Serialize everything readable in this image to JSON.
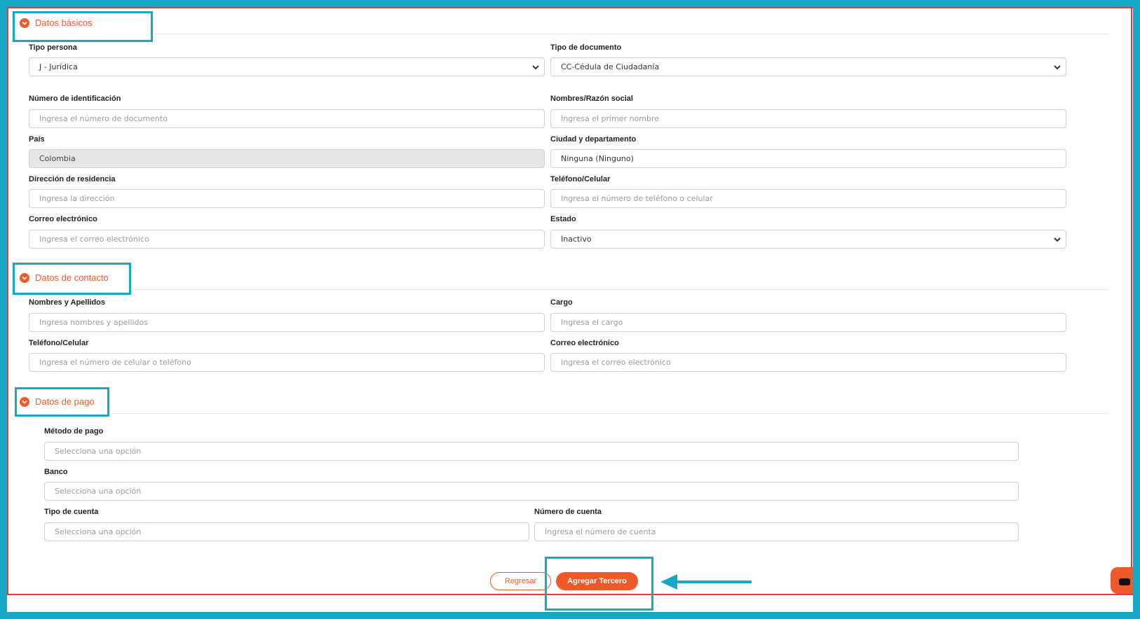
{
  "sections": {
    "basic": "Datos básicos",
    "contact": "Datos de contacto",
    "payment": "Datos de pago"
  },
  "basic": {
    "tipo_persona": {
      "label": "Tipo persona",
      "value": "J - Jurídica"
    },
    "tipo_documento": {
      "label": "Tipo de documento",
      "value": "CC-Cédula de Ciudadanía"
    },
    "numero_id": {
      "label": "Número de identificación",
      "placeholder": "Ingresa el número de documento"
    },
    "nombres": {
      "label": "Nombres/Razón social",
      "placeholder": "Ingresa el primer nombre"
    },
    "pais": {
      "label": "País",
      "value": "Colombia"
    },
    "ciudad": {
      "label": "Ciudad y departamento",
      "value": "Ninguna (Ninguno)"
    },
    "direccion": {
      "label": "Dirección de residencia",
      "placeholder": "Ingresa la dirección"
    },
    "telefono": {
      "label": "Teléfono/Celular",
      "placeholder": "Ingresa el número de teléfono o celular"
    },
    "correo": {
      "label": "Correo electrónico",
      "placeholder": "Ingresa el correo electrónico"
    },
    "estado": {
      "label": "Estado",
      "value": "Inactivo"
    }
  },
  "contact": {
    "nombres": {
      "label": "Nombres y Apellidos",
      "placeholder": "Ingresa nombres y apellidos"
    },
    "cargo": {
      "label": "Cargo",
      "placeholder": "Ingresa el cargo"
    },
    "telefono": {
      "label": "Teléfono/Celular",
      "placeholder": "Ingresa el número de celular o teléfono"
    },
    "correo": {
      "label": "Correo electrónico",
      "placeholder": "Ingresa el correo electrónico"
    }
  },
  "payment": {
    "metodo": {
      "label": "Método de pago",
      "placeholder": "Selecciona una opción"
    },
    "banco": {
      "label": "Banco",
      "placeholder": "Selecciona una opción"
    },
    "tipo_cuenta": {
      "label": "Tipo de cuenta",
      "placeholder": "Selecciona una opción"
    },
    "numero_cuenta": {
      "label": "Número de cuenta",
      "placeholder": "Ingresa el número de cuenta"
    }
  },
  "actions": {
    "back": "Regresar",
    "submit": "Agregar Tercero"
  },
  "colors": {
    "accent": "#f0592a",
    "highlight": "#16a8c7",
    "frame_line": "#e53935"
  }
}
